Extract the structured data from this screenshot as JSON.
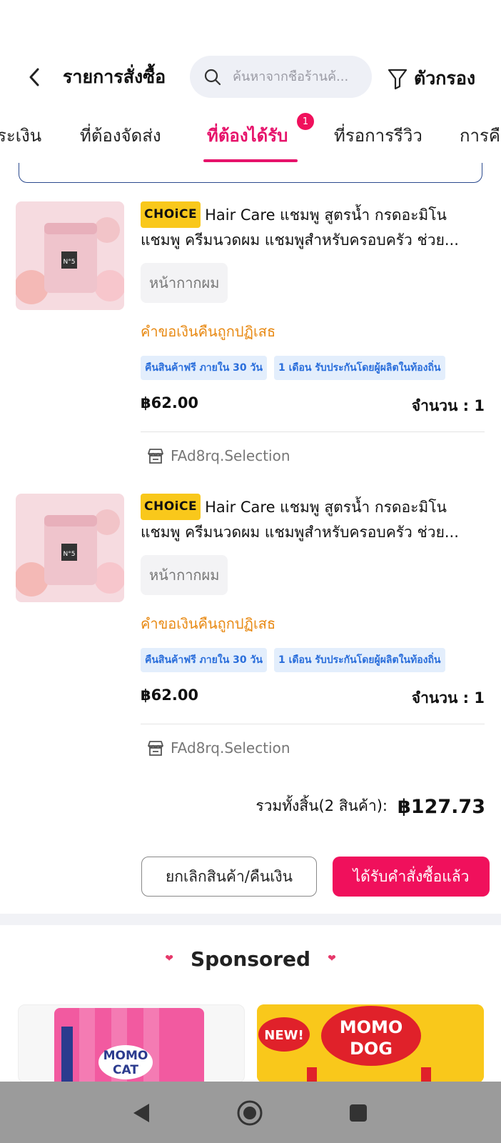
{
  "header": {
    "title": "รายการสั่งซื้อ",
    "search_placeholder": "ค้นหาจากชื่อร้านค้...",
    "filter_label": "ตัวกรอง"
  },
  "tabs": [
    {
      "label": "ระเงิน",
      "active": false
    },
    {
      "label": "ที่ต้องจัดส่ง",
      "active": false
    },
    {
      "label": "ที่ต้องได้รับ",
      "active": true,
      "badge": "1"
    },
    {
      "label": "ที่รอการรีวิว",
      "active": false
    },
    {
      "label": "การคื",
      "active": false
    }
  ],
  "items": [
    {
      "badge": "CHOiCE",
      "title": "Hair Care แชมพู สูตรน้ำ กรดอะมิโน แชมพู ครีมนวดผม แชมพูสำหรับครอบครัว ช่วย...",
      "variant": "หน้ากากผม",
      "status": "คำขอเงินคืนถูกปฏิเสธ",
      "tags": [
        "คืนสินค้าฟรี ภายใน 30 วัน",
        "1 เดือน รับประกันโดยผู้ผลิตในท้องถิ่น"
      ],
      "price": "฿62.00",
      "quantity": "จำนวน : 1",
      "store": "FAd8rq.Selection"
    },
    {
      "badge": "CHOiCE",
      "title": "Hair Care แชมพู สูตรน้ำ กรดอะมิโน แชมพู ครีมนวดผม แชมพูสำหรับครอบครัว ช่วย...",
      "variant": "หน้ากากผม",
      "status": "คำขอเงินคืนถูกปฏิเสธ",
      "tags": [
        "คืนสินค้าฟรี ภายใน 30 วัน",
        "1 เดือน รับประกันโดยผู้ผลิตในท้องถิ่น"
      ],
      "price": "฿62.00",
      "quantity": "จำนวน : 1",
      "store": "FAd8rq.Selection"
    }
  ],
  "summary": {
    "total_label": "รวมทั้งสิ้น(2 สินค้า):",
    "total_value": "฿127.73"
  },
  "actions": {
    "cancel_label": "ยกเลิกสินค้า/คืนเงิน",
    "confirm_label": "ได้รับคำสั่งซื้อแล้ว"
  },
  "sponsored": {
    "title": "Sponsored",
    "ads": [
      {
        "brand": "MOMO CAT"
      },
      {
        "brand": "MOMO DOG",
        "badge": "NEW!"
      }
    ]
  },
  "colors": {
    "accent": "#e6126a",
    "choice_yellow": "#f9c81b",
    "status_orange": "#e88a14",
    "tag_blue": "#2a6edb"
  },
  "icons": [
    "chevron-left-icon",
    "search-icon",
    "filter-icon",
    "store-icon",
    "back-nav-icon",
    "home-nav-icon",
    "recents-nav-icon"
  ]
}
